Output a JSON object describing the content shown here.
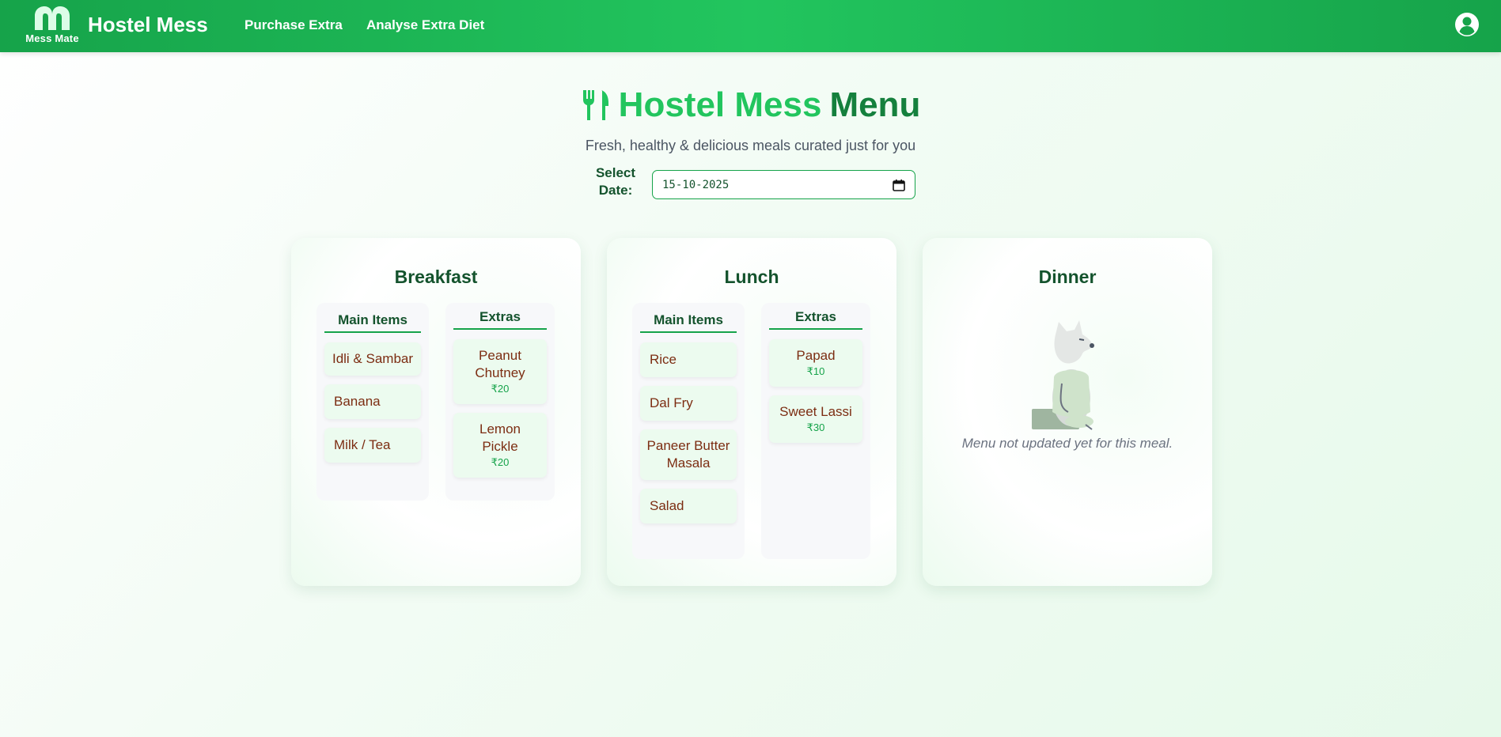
{
  "navbar": {
    "logo_caption": "Mess Mate",
    "brand_title": "Hostel Mess",
    "links": [
      "Purchase Extra",
      "Analyse Extra Diet"
    ],
    "profile_icon": "user-circle-icon"
  },
  "header": {
    "title_part1": "Hostel Mess",
    "title_part2": "Menu",
    "title_icon": "fork-knife-icon",
    "subtitle": "Fresh, healthy & delicious meals curated just for you",
    "date_label": "Select Date:",
    "date_value": "15-10-2025"
  },
  "meals": {
    "breakfast": {
      "title": "Breakfast",
      "main_head": "Main Items",
      "extras_head": "Extras",
      "main_items": [
        "Idli & Sambar",
        "Banana",
        "Milk / Tea"
      ],
      "extras": [
        {
          "name": "Peanut Chutney",
          "price": "₹20"
        },
        {
          "name": "Lemon Pickle",
          "price": "₹20"
        }
      ]
    },
    "lunch": {
      "title": "Lunch",
      "main_head": "Main Items",
      "extras_head": "Extras",
      "main_items": [
        "Rice",
        "Dal Fry",
        "Paneer Butter Masala",
        "Salad"
      ],
      "extras": [
        {
          "name": "Papad",
          "price": "₹10"
        },
        {
          "name": "Sweet Lassi",
          "price": "₹30"
        }
      ]
    },
    "dinner": {
      "title": "Dinner",
      "empty_message": "Menu not updated yet for this meal."
    }
  },
  "colors": {
    "brand_green": "#22c55e",
    "dark_green": "#14532d",
    "item_text": "#7c2d12",
    "price_green": "#16a34a"
  }
}
